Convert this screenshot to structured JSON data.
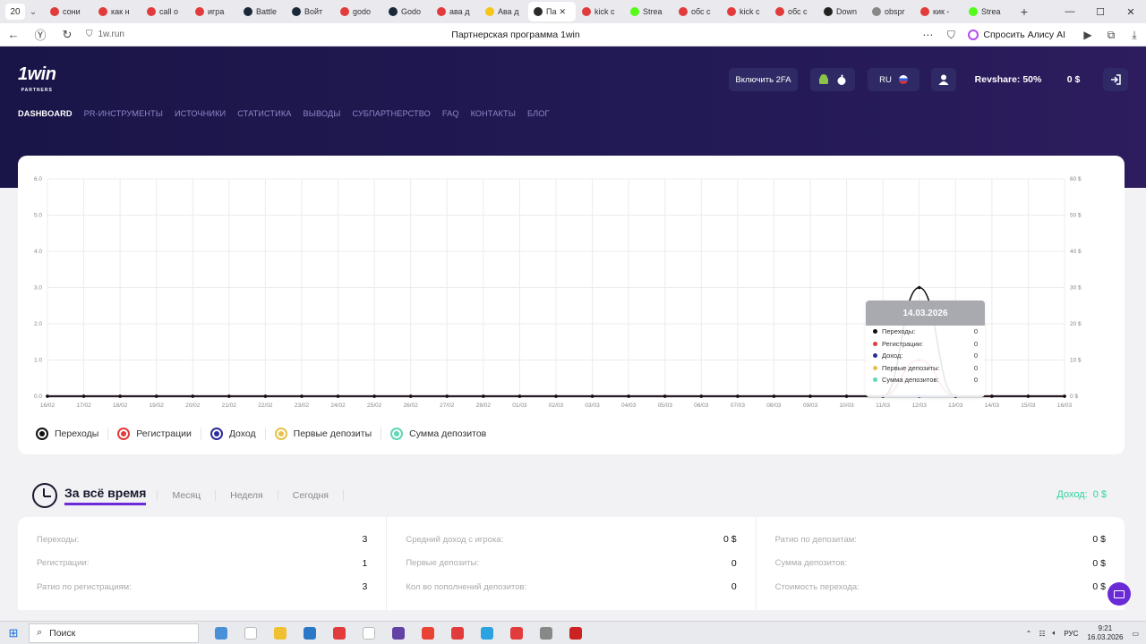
{
  "browser": {
    "tab_count": "20",
    "tabs": [
      {
        "label": "сони",
        "color": "#e23b3b"
      },
      {
        "label": "как н",
        "color": "#e23b3b"
      },
      {
        "label": "call o",
        "color": "#e23b3b"
      },
      {
        "label": "игра",
        "color": "#e23b3b"
      },
      {
        "label": "Battle",
        "color": "#1b2838"
      },
      {
        "label": "Войт",
        "color": "#1b2838"
      },
      {
        "label": "godo",
        "color": "#e23b3b"
      },
      {
        "label": "Godo",
        "color": "#1b2838"
      },
      {
        "label": "ава д",
        "color": "#e23b3b"
      },
      {
        "label": "Ава д",
        "color": "#f5c518"
      },
      {
        "label": "Па",
        "color": "#2a2a2a",
        "active": true
      },
      {
        "label": "kick c",
        "color": "#e23b3b"
      },
      {
        "label": "Strea",
        "color": "#53fc18"
      },
      {
        "label": "обс с",
        "color": "#e23b3b"
      },
      {
        "label": "kick c",
        "color": "#e23b3b"
      },
      {
        "label": "обс с",
        "color": "#e23b3b"
      },
      {
        "label": "Down",
        "color": "#222222"
      },
      {
        "label": "obspr",
        "color": "#888888"
      },
      {
        "label": "кик -",
        "color": "#e23b3b"
      },
      {
        "label": "Strea",
        "color": "#53fc18"
      }
    ],
    "url": "1w.run",
    "page_title": "Партнерская программа 1win",
    "alice_label": "Спросить Алису AI"
  },
  "header": {
    "logo": "1win",
    "logo_sub": "PARTNERS",
    "nav": [
      "DASHBOARD",
      "PR-ИНСТРУМЕНТЫ",
      "ИСТОЧНИКИ",
      "СТАТИСТИКА",
      "ВЫВОДЫ",
      "СУБПАРТНЕРСТВО",
      "FAQ",
      "КОНТАКТЫ",
      "БЛОГ"
    ],
    "enable_2fa": "Включить 2FA",
    "lang": "RU",
    "revshare": "Revshare: 50%",
    "balance": "0 $"
  },
  "chart_data": {
    "type": "line",
    "x": [
      "16/02",
      "17/02",
      "18/02",
      "19/02",
      "20/02",
      "21/02",
      "22/02",
      "23/02",
      "24/02",
      "25/02",
      "26/02",
      "27/02",
      "28/02",
      "01/03",
      "02/03",
      "03/03",
      "04/03",
      "05/03",
      "06/03",
      "07/03",
      "08/03",
      "09/03",
      "10/03",
      "11/03",
      "12/03",
      "13/03",
      "14/03",
      "15/03",
      "16/03"
    ],
    "left_ticks": [
      "0.0",
      "1.0",
      "2.0",
      "3.0",
      "4.0",
      "5.0",
      "6.0"
    ],
    "right_ticks": [
      "0 $",
      "10 $",
      "20 $",
      "30 $",
      "40 $",
      "50 $",
      "60 $"
    ],
    "ylim": [
      0,
      6
    ],
    "ylim_right": [
      0,
      60
    ],
    "series": [
      {
        "name": "Переходы",
        "color": "#111111",
        "values": [
          0,
          0,
          0,
          0,
          0,
          0,
          0,
          0,
          0,
          0,
          0,
          0,
          0,
          0,
          0,
          0,
          0,
          0,
          0,
          0,
          0,
          0,
          0,
          0,
          3,
          0,
          0,
          0,
          0
        ]
      },
      {
        "name": "Регистрации",
        "color": "#e23b3b",
        "values": [
          0,
          0,
          0,
          0,
          0,
          0,
          0,
          0,
          0,
          0,
          0,
          0,
          0,
          0,
          0,
          0,
          0,
          0,
          0,
          0,
          0,
          0,
          0,
          0,
          1,
          0,
          0,
          0,
          0
        ]
      },
      {
        "name": "Доход",
        "color": "#2c2c9a",
        "values": [
          0,
          0,
          0,
          0,
          0,
          0,
          0,
          0,
          0,
          0,
          0,
          0,
          0,
          0,
          0,
          0,
          0,
          0,
          0,
          0,
          0,
          0,
          0,
          0,
          0,
          0,
          0,
          0,
          0
        ]
      },
      {
        "name": "Первые депозиты",
        "color": "#e8c14a",
        "values": [
          0,
          0,
          0,
          0,
          0,
          0,
          0,
          0,
          0,
          0,
          0,
          0,
          0,
          0,
          0,
          0,
          0,
          0,
          0,
          0,
          0,
          0,
          0,
          0,
          0,
          0,
          0,
          0,
          0
        ]
      },
      {
        "name": "Сумма депозитов",
        "color": "#5fd6b6",
        "values": [
          0,
          0,
          0,
          0,
          0,
          0,
          0,
          0,
          0,
          0,
          0,
          0,
          0,
          0,
          0,
          0,
          0,
          0,
          0,
          0,
          0,
          0,
          0,
          0,
          0,
          0,
          0,
          0,
          0
        ]
      }
    ],
    "grid": true,
    "legend": "bottom-left",
    "tooltip": {
      "date": "14.03.2026",
      "rows": [
        {
          "label": "Переходы:",
          "value": "0",
          "color": "#111111"
        },
        {
          "label": "Регистрации:",
          "value": "0",
          "color": "#e23b3b"
        },
        {
          "label": "Доход:",
          "value": "0",
          "color": "#2c2c9a"
        },
        {
          "label": "Первые депозиты:",
          "value": "0",
          "color": "#e8c14a"
        },
        {
          "label": "Сумма депозитов:",
          "value": "0",
          "color": "#5fd6b6"
        }
      ]
    }
  },
  "periods": {
    "active": "За всё время",
    "others": [
      "Месяц",
      "Неделя",
      "Сегодня"
    ],
    "income_label": "Доход:",
    "income_value": "0 $"
  },
  "stats": [
    [
      {
        "label": "Переходы:",
        "value": "3"
      },
      {
        "label": "Регистрации:",
        "value": "1"
      },
      {
        "label": "Ратио по регистрациям:",
        "value": "3"
      }
    ],
    [
      {
        "label": "Средний доход с игрока:",
        "value": "0 $"
      },
      {
        "label": "Первые депозиты:",
        "value": "0"
      },
      {
        "label": "Кол во пополнений депозитов:",
        "value": "0"
      }
    ],
    [
      {
        "label": "Ратио по депозитам:",
        "value": "0 $"
      },
      {
        "label": "Сумма депозитов:",
        "value": "0 $"
      },
      {
        "label": "Стоимость перехода:",
        "value": "0 $"
      }
    ]
  ],
  "taskbar": {
    "search": "Поиск",
    "apps": [
      "#4a90d9",
      "#ffffff",
      "#f0c030",
      "#2c78c8",
      "#e23b3b",
      "#ffffff",
      "#6441a5",
      "#ea4335",
      "#e23b3b",
      "#2aa3e0",
      "#e23b3b",
      "#888888",
      "#cc2222"
    ],
    "lang": "РУС",
    "time": "9:21",
    "date": "16.03.2026"
  }
}
